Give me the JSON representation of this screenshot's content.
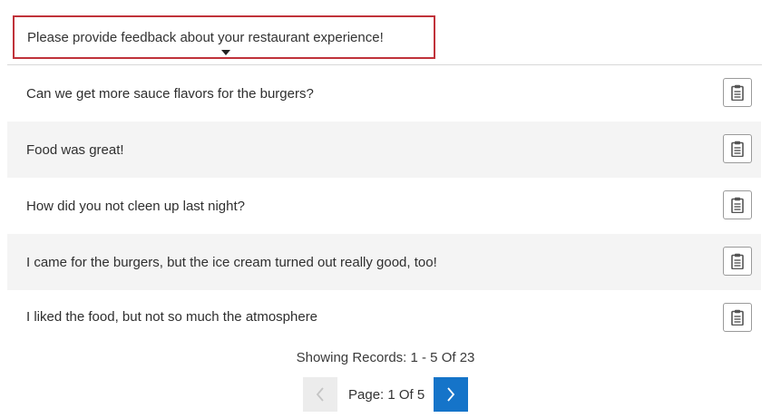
{
  "question": {
    "text": "Please provide feedback about your restaurant experience!",
    "caret_icon": "caret-down-icon"
  },
  "responses": [
    {
      "text": "Can we get more sauce flavors for the burgers?",
      "action_icon": "clipboard-icon"
    },
    {
      "text": "Food was great!",
      "action_icon": "clipboard-icon"
    },
    {
      "text": "How did you not cleen up last night?",
      "action_icon": "clipboard-icon"
    },
    {
      "text": "I came for the burgers, but the ice cream turned out really good, too!",
      "action_icon": "clipboard-icon"
    },
    {
      "text": "I liked the food, but not so much the atmosphere",
      "action_icon": "clipboard-icon"
    }
  ],
  "footer": {
    "records_text": "Showing Records: 1 - 5 Of 23",
    "page_text": "Page: 1 Of 5",
    "prev_icon": "chevron-left-icon",
    "next_icon": "chevron-right-icon"
  },
  "colors": {
    "selector_border": "#c0323a",
    "next_button": "#1574c9",
    "alt_row": "#f4f4f4"
  }
}
